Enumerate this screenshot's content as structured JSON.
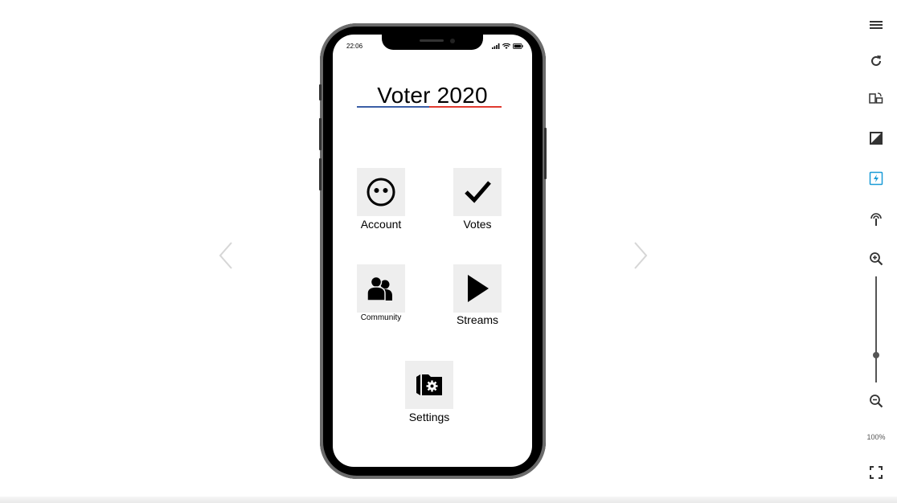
{
  "status_bar": {
    "time": "22:06"
  },
  "app": {
    "title": "Voter 2020"
  },
  "tiles": {
    "account": {
      "label": "Account",
      "icon": "smiley-face-icon"
    },
    "votes": {
      "label": "Votes",
      "icon": "checkmark-icon"
    },
    "community": {
      "label": "Community",
      "icon": "people-icon"
    },
    "streams": {
      "label": "Streams",
      "icon": "play-icon"
    },
    "settings": {
      "label": "Settings",
      "icon": "folder-gear-icon"
    }
  },
  "toolbar": {
    "zoom_level": "100%",
    "items": [
      "menu-icon",
      "refresh-icon",
      "rotate-device-icon",
      "contrast-icon",
      "flash-icon",
      "touch-icon",
      "zoom-in-icon",
      "zoom-out-icon",
      "fullscreen-icon"
    ]
  },
  "colors": {
    "underline_blue": "#3b5fa6",
    "underline_red": "#e03a2f",
    "tile_bg": "#eeeeee",
    "accent_teal": "#1a9bd7"
  }
}
